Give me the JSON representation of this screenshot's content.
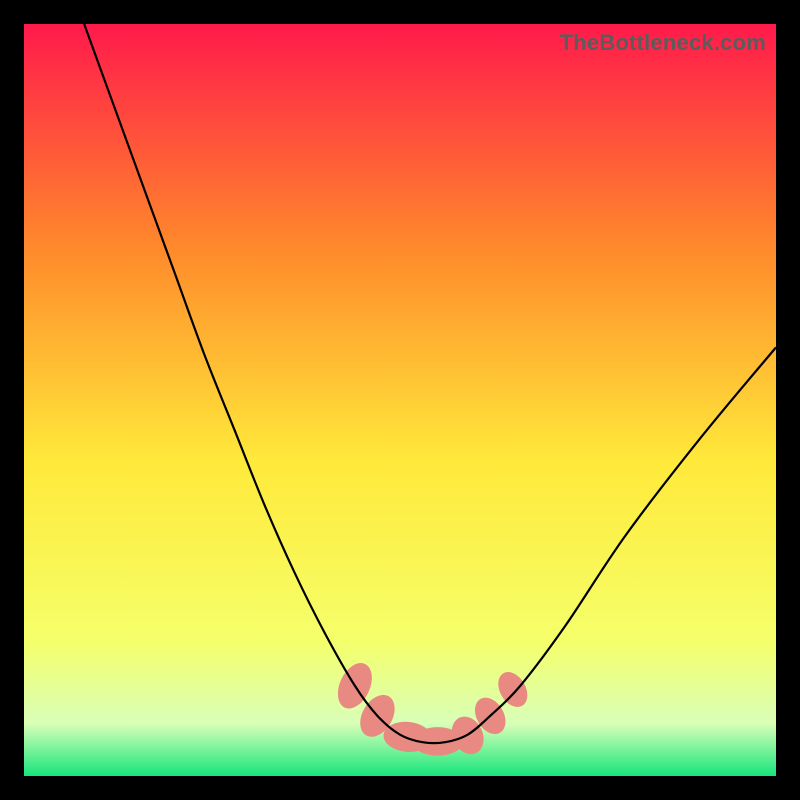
{
  "watermark": "TheBottleneck.com",
  "chart_data": {
    "type": "line",
    "title": "",
    "xlabel": "",
    "ylabel": "",
    "xlim": [
      0,
      100
    ],
    "ylim": [
      0,
      100
    ],
    "gradient_colors": {
      "top": "#ff1a4b",
      "mid_upper": "#ff8a2b",
      "mid": "#ffe93a",
      "mid_lower": "#f5ff6a",
      "bottom": "#17e57c"
    },
    "series": [
      {
        "name": "curve",
        "x": [
          8,
          12,
          16,
          20,
          24,
          28,
          32,
          36,
          40,
          44,
          47,
          50,
          53,
          56,
          59,
          62,
          66,
          72,
          80,
          90,
          100
        ],
        "y": [
          100,
          89,
          78,
          67,
          56,
          46,
          36,
          27,
          19,
          12,
          8,
          5.5,
          4.5,
          4.5,
          5.5,
          8,
          12,
          20,
          32,
          45,
          57
        ]
      }
    ],
    "highlight_points": {
      "name": "bottom-blobs",
      "color": "#e88a82",
      "points": [
        {
          "x": 44,
          "y": 12,
          "rx": 2.0,
          "ry": 3.2,
          "rot": 25
        },
        {
          "x": 47,
          "y": 8,
          "rx": 2.0,
          "ry": 3.0,
          "rot": 30
        },
        {
          "x": 51,
          "y": 5.2,
          "rx": 3.2,
          "ry": 2.0,
          "rot": 5
        },
        {
          "x": 55,
          "y": 4.6,
          "rx": 3.4,
          "ry": 1.9,
          "rot": 0
        },
        {
          "x": 59,
          "y": 5.4,
          "rx": 2.0,
          "ry": 2.6,
          "rot": -25
        },
        {
          "x": 62,
          "y": 8,
          "rx": 1.8,
          "ry": 2.6,
          "rot": -30
        },
        {
          "x": 65,
          "y": 11.5,
          "rx": 1.7,
          "ry": 2.5,
          "rot": -30
        }
      ]
    }
  }
}
